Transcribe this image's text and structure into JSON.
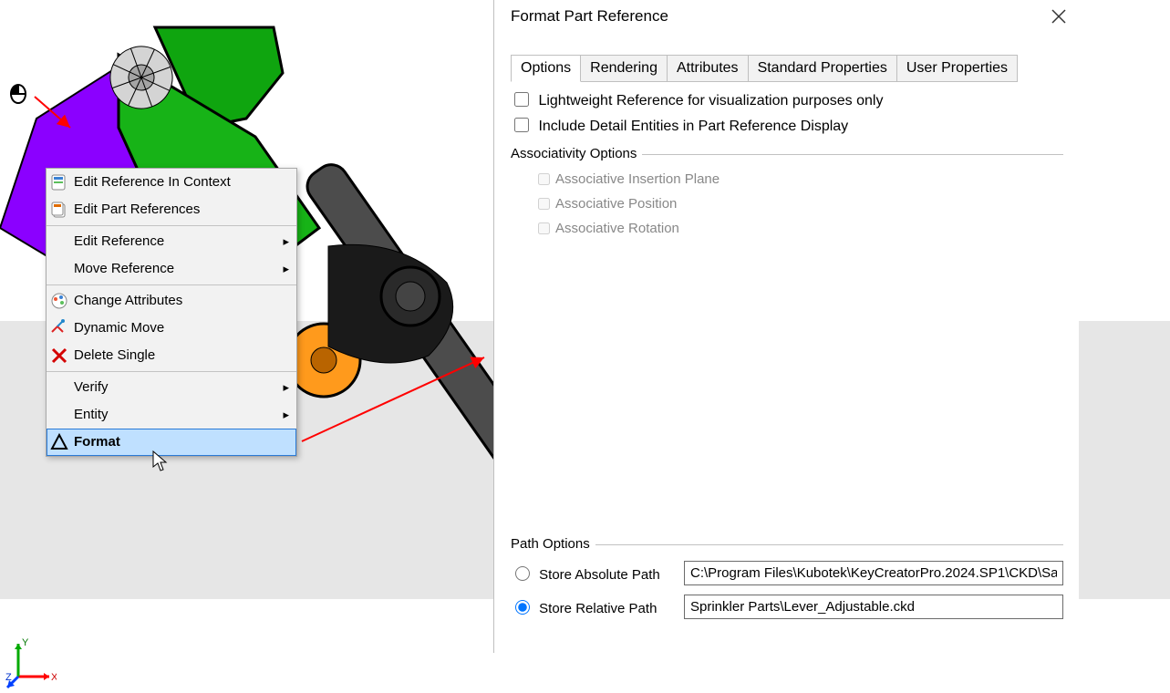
{
  "dialog": {
    "title": "Format Part Reference",
    "tabs": {
      "options": "Options",
      "rendering": "Rendering",
      "attributes": "Attributes",
      "standard": "Standard Properties",
      "user": "User Properties"
    },
    "cb_lightweight": "Lightweight Reference for visualization purposes only",
    "cb_detail": "Include Detail Entities in Part Reference Display",
    "assoc_title": "Associativity Options",
    "assoc": {
      "plane": "Associative Insertion Plane",
      "position": "Associative Position",
      "rotation": "Associative Rotation"
    },
    "path_title": "Path Options",
    "path": {
      "abs_label": "Store Absolute Path",
      "rel_label": "Store Relative Path",
      "abs_value": "C:\\Program Files\\Kubotek\\KeyCreatorPro.2024.SP1\\CKD\\Sa",
      "rel_value": "Sprinkler Parts\\Lever_Adjustable.ckd"
    }
  },
  "ctx": {
    "edit_in_context": "Edit Reference In Context",
    "edit_refs": "Edit Part References",
    "edit_ref": "Edit Reference",
    "move_ref": "Move Reference",
    "change_attr": "Change Attributes",
    "dynamic_move": "Dynamic Move",
    "delete_single": "Delete Single",
    "verify": "Verify",
    "entity": "Entity",
    "format": "Format"
  },
  "axes": {
    "x": "X",
    "y": "Y",
    "z": "Z"
  }
}
